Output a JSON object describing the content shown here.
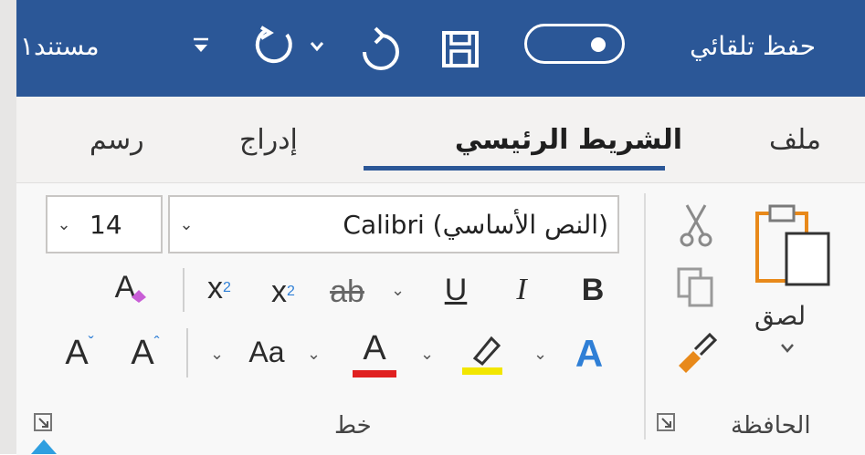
{
  "titlebar": {
    "autosave_label": "حفظ تلقائي",
    "autosave_on": true,
    "doc_title": "مستند١"
  },
  "tabs": [
    {
      "label": "ملف",
      "active": false
    },
    {
      "label": "الشريط الرئيسي",
      "active": true
    },
    {
      "label": "إدراج",
      "active": false
    },
    {
      "label": "رسم",
      "active": false
    }
  ],
  "clipboard": {
    "group_label": "الحافظة",
    "paste_label": "لصق"
  },
  "font": {
    "group_label": "خط",
    "font_name": "(النص الأساسي) Calibri",
    "font_size": "14",
    "bold": "B",
    "italic": "I",
    "underline": "U",
    "strikethrough": "ab",
    "subscript": "x",
    "superscript": "x",
    "clear_format": "A",
    "change_case": "Aa",
    "grow_font": "A",
    "shrink_font": "A",
    "font_color": "A",
    "text_effects": "A"
  },
  "colors": {
    "titlebar": "#2b5797",
    "font_color_bar": "#e02020",
    "highlight_bar": "#f2e600",
    "text_effects": "#2f7fd6",
    "accent": "#2b5797"
  }
}
